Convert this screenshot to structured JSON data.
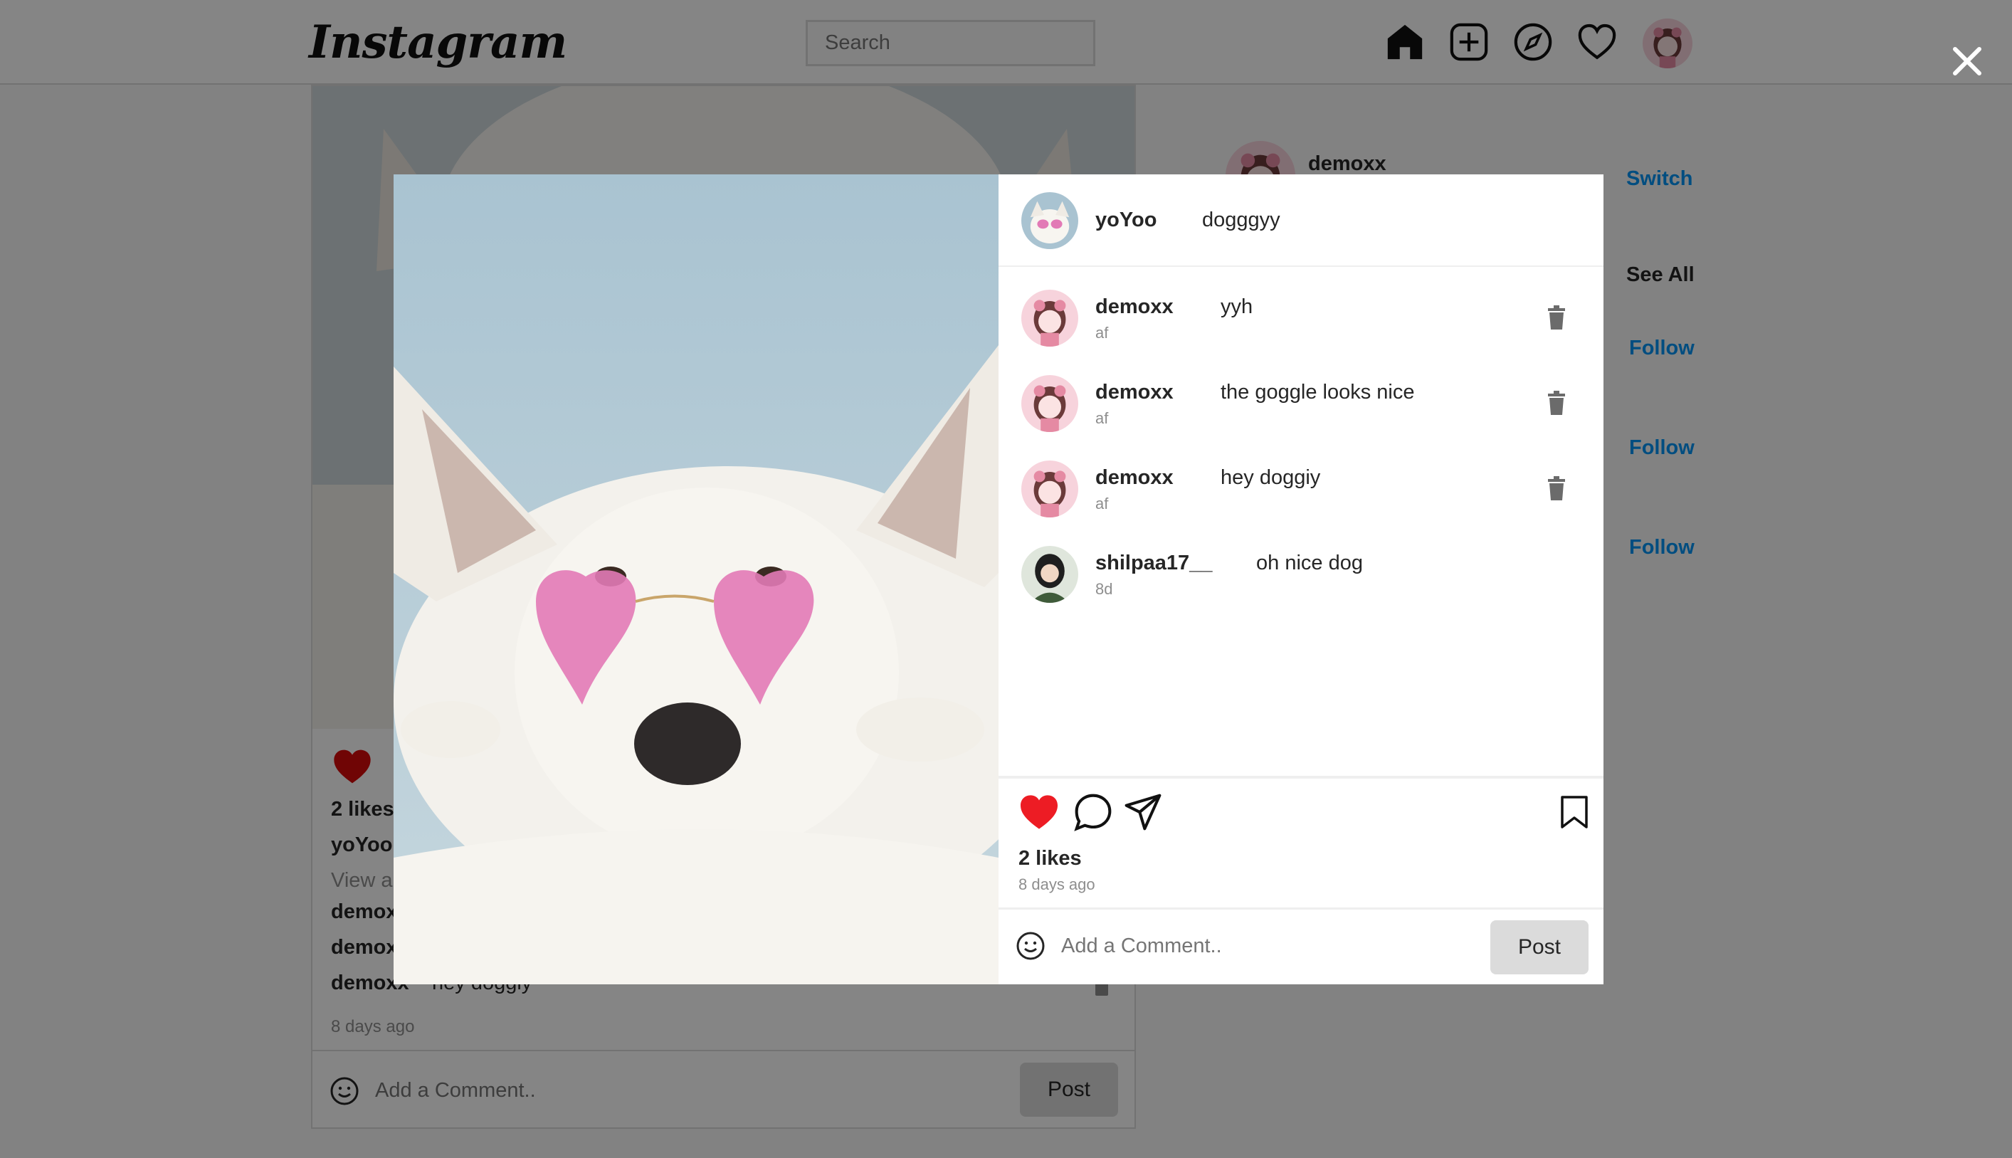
{
  "app": {
    "logo_text": "Instagram"
  },
  "nav": {
    "search_placeholder": "Search",
    "icons": [
      "home-icon",
      "new-post-icon",
      "explore-icon",
      "activity-heart-icon",
      "profile-avatar"
    ]
  },
  "feed_post": {
    "likes": "2 likes",
    "caption_user": "yoYoo",
    "view_all": "View al",
    "comments": [
      {
        "user": "demox"
      },
      {
        "user": "demox"
      },
      {
        "user": "demoxx",
        "text": "hey doggiy"
      }
    ],
    "time": "8 days ago",
    "comment_placeholder": "Add a Comment..",
    "post_label": "Post"
  },
  "sidebar": {
    "username": "demoxx",
    "switch_label": "Switch",
    "see_all_label": "See All",
    "follow_labels": [
      "Follow",
      "Follow",
      "Follow"
    ]
  },
  "modal": {
    "author": {
      "user": "yoYoo",
      "caption": "dogggyy"
    },
    "comments": [
      {
        "user": "demoxx",
        "text": "yyh",
        "time": "af",
        "deletable": true
      },
      {
        "user": "demoxx",
        "text": "the goggle looks nice",
        "time": "af",
        "deletable": true
      },
      {
        "user": "demoxx",
        "text": "hey doggiy",
        "time": "af",
        "deletable": true
      },
      {
        "user": "shilpaa17__",
        "text": "oh nice dog",
        "time": "8d",
        "deletable": false
      }
    ],
    "likes": "2 likes",
    "time": "8 days ago",
    "comment_placeholder": "Add a Comment..",
    "post_label": "Post",
    "liked": true
  },
  "colors": {
    "like_red": "#ed1c24",
    "link_blue": "#0095f6",
    "overlay": "rgba(0,0,0,0.48)"
  }
}
